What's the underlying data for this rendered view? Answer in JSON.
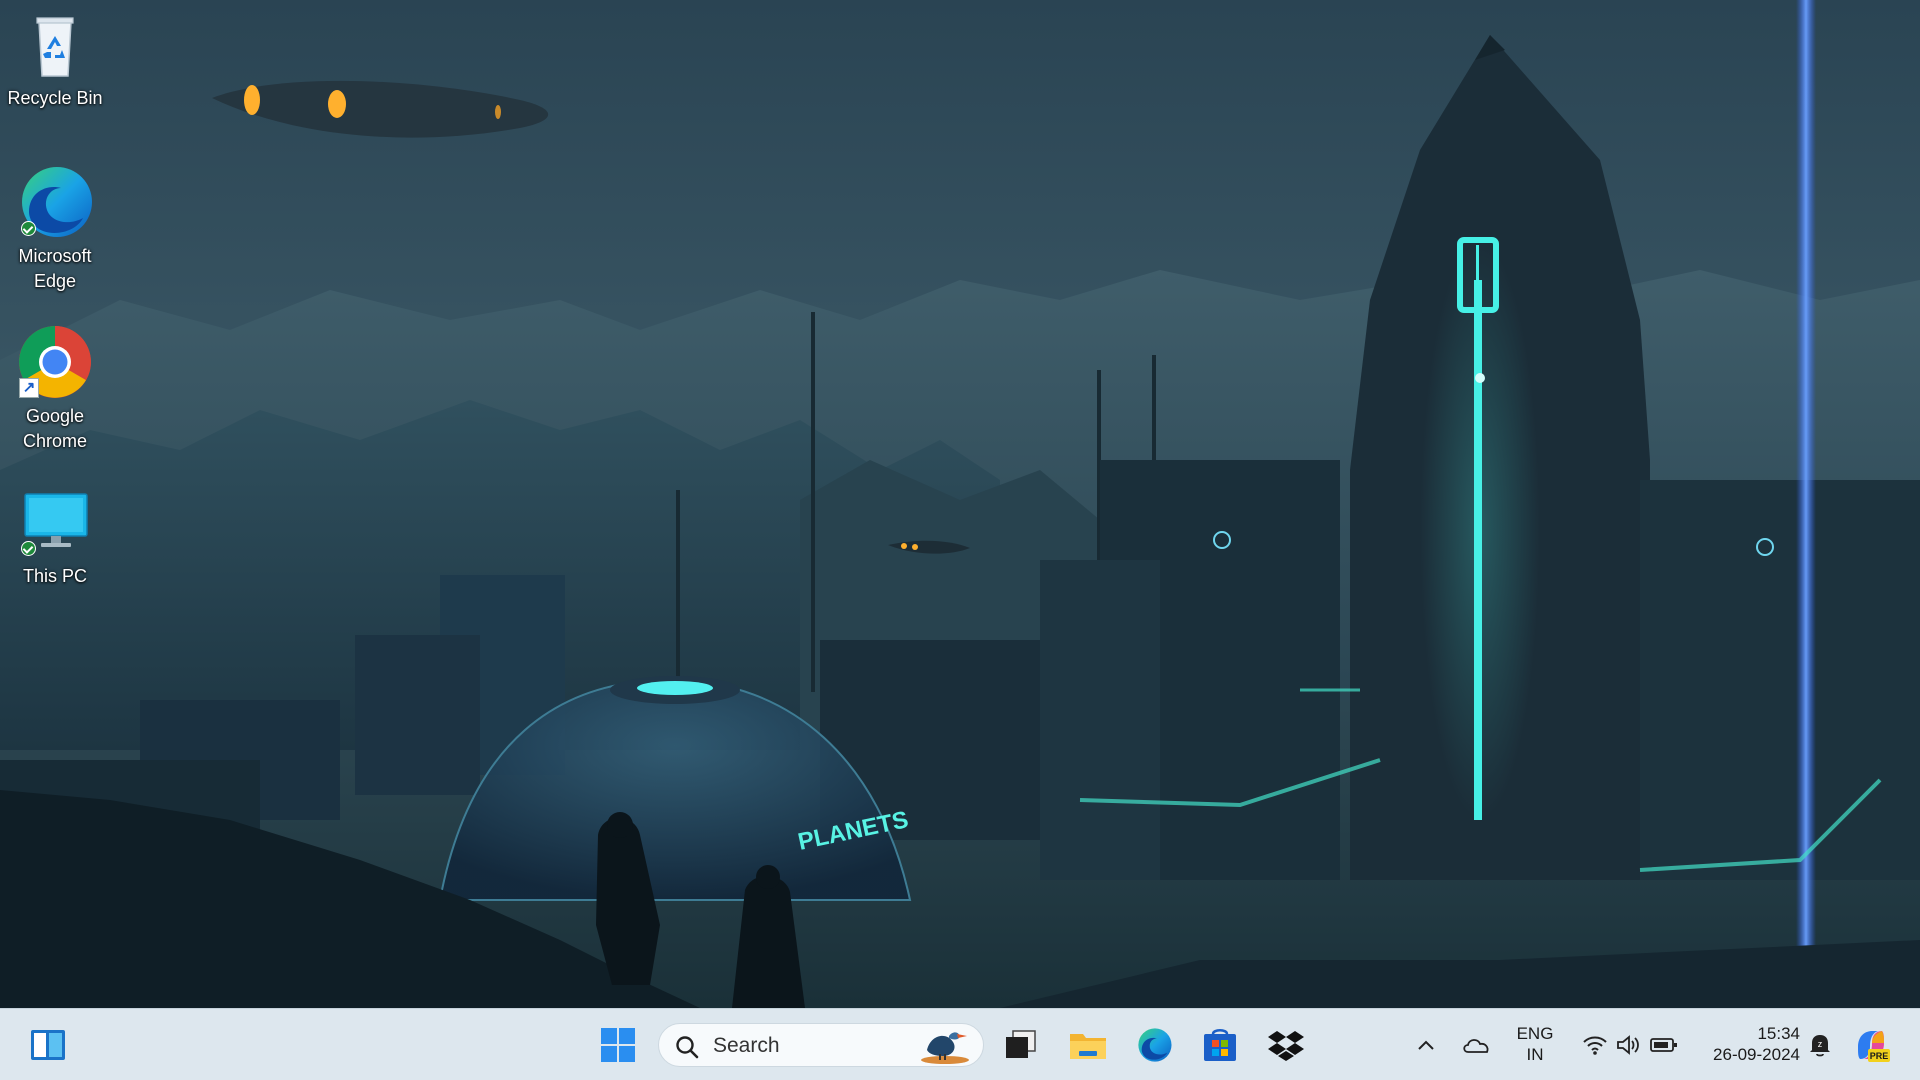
{
  "desktop": {
    "icons": [
      {
        "name": "recycle-bin",
        "label": "Recycle Bin",
        "icon": "recycle-bin-icon"
      },
      {
        "name": "microsoft-edge",
        "label": "Microsoft Edge",
        "icon": "edge-icon",
        "synced": true
      },
      {
        "name": "google-chrome",
        "label": "Google Chrome",
        "icon": "chrome-icon",
        "shortcut": true
      },
      {
        "name": "this-pc",
        "label": "This PC",
        "icon": "monitor-icon",
        "synced": true
      }
    ],
    "wallpaper_sign": "PLANETS"
  },
  "taskbar": {
    "widgets_icon": "widgets-icon",
    "start_icon": "windows-start-icon",
    "search": {
      "placeholder": "Search",
      "icon": "search-icon",
      "highlight_icon": "search-highlight-bird-icon"
    },
    "pinned": [
      {
        "name": "task-view",
        "icon": "task-view-icon"
      },
      {
        "name": "file-explorer",
        "icon": "folder-icon"
      },
      {
        "name": "edge",
        "icon": "edge-icon"
      },
      {
        "name": "microsoft-store",
        "icon": "store-icon"
      },
      {
        "name": "dropbox",
        "icon": "dropbox-icon"
      }
    ],
    "tray": {
      "overflow_icon": "chevron-up-icon",
      "cloud_icon": "onedrive-cloud-icon",
      "language_line1": "ENG",
      "language_line2": "IN",
      "wifi_icon": "wifi-icon",
      "volume_icon": "volume-icon",
      "battery_icon": "battery-icon",
      "time": "15:34",
      "date": "26-09-2024",
      "notification_icon": "notification-do-not-disturb-icon",
      "copilot_icon": "copilot-pre-icon",
      "copilot_badge": "PRE"
    }
  },
  "colors": {
    "taskbar_bg": "#dde7ee",
    "wallpaper_sky": "#2c4a5a",
    "neon": "#3fe6e0"
  }
}
